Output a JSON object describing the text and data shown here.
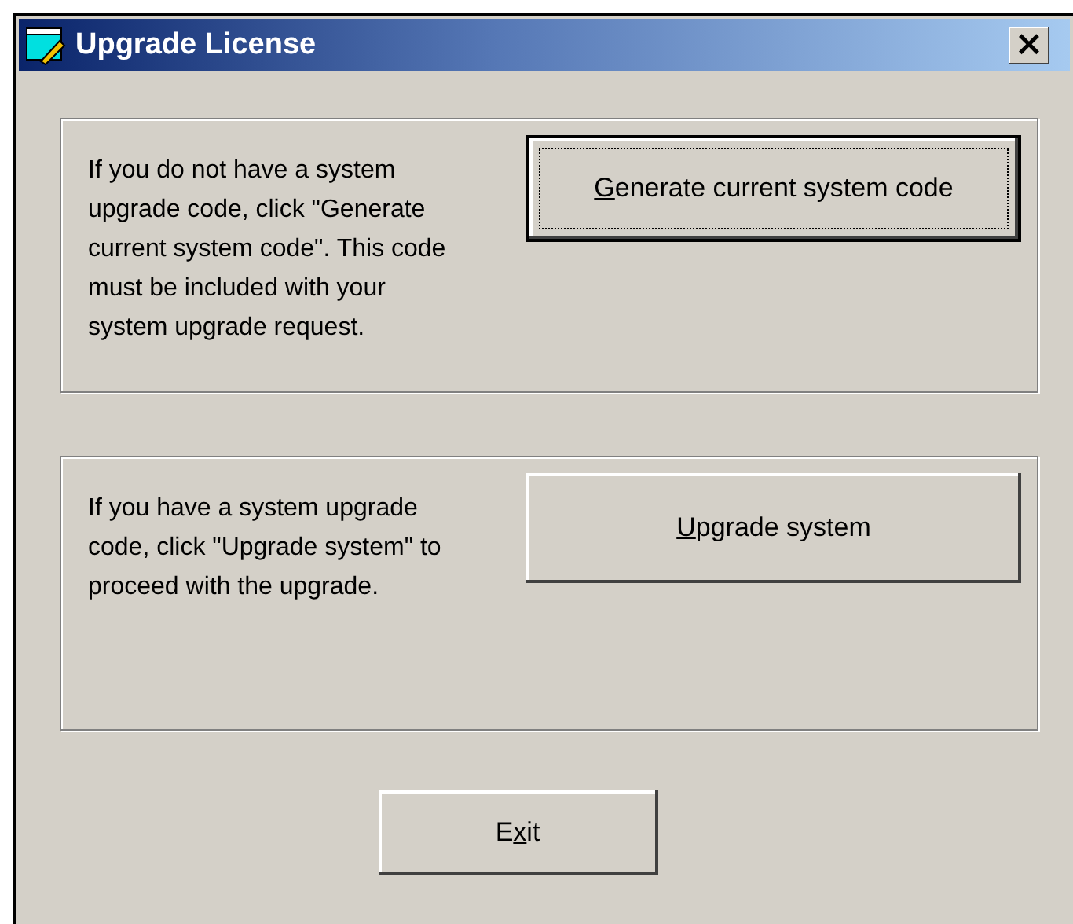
{
  "window": {
    "title": "Upgrade License",
    "close": "×"
  },
  "sections": [
    {
      "text": "If you do not have a system upgrade code, click \"Generate current system code\". This code must be included with your system upgrade request.",
      "button": {
        "key": "G",
        "post": "enerate current system code",
        "default": true
      }
    },
    {
      "text": "If you have a system upgrade code, click \"Upgrade system\" to proceed with the upgrade.",
      "button": {
        "key": "U",
        "post": "pgrade system",
        "default": false
      }
    }
  ],
  "exit_button": {
    "pre": "E",
    "key": "x",
    "post": "it"
  }
}
